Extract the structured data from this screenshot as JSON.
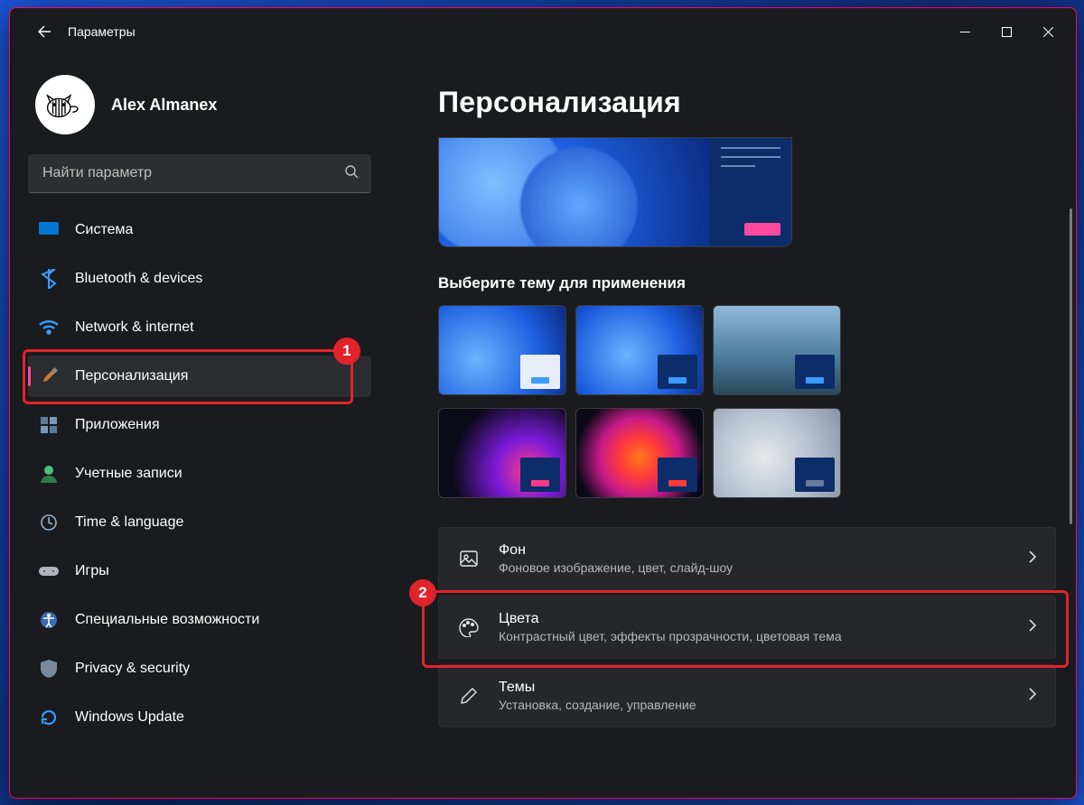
{
  "titlebar": {
    "title": "Параметры"
  },
  "profile": {
    "name": "Alex Almanex"
  },
  "search": {
    "placeholder": "Найти параметр"
  },
  "sidebar": {
    "items": [
      {
        "label": "Система"
      },
      {
        "label": "Bluetooth & devices"
      },
      {
        "label": "Network & internet"
      },
      {
        "label": "Персонализация"
      },
      {
        "label": "Приложения"
      },
      {
        "label": "Учетные записи"
      },
      {
        "label": "Time & language"
      },
      {
        "label": "Игры"
      },
      {
        "label": "Специальные возможности"
      },
      {
        "label": "Privacy & security"
      },
      {
        "label": "Windows Update"
      }
    ]
  },
  "page": {
    "title": "Персонализация",
    "select_theme": "Выберите тему для применения"
  },
  "rows": {
    "background": {
      "title": "Фон",
      "sub": "Фоновое изображение, цвет, слайд-шоу"
    },
    "colors": {
      "title": "Цвета",
      "sub": "Контрастный цвет, эффекты прозрачности, цветовая тема"
    },
    "themes": {
      "title": "Темы",
      "sub": "Установка, создание, управление"
    }
  },
  "annotations": {
    "one": "1",
    "two": "2"
  }
}
